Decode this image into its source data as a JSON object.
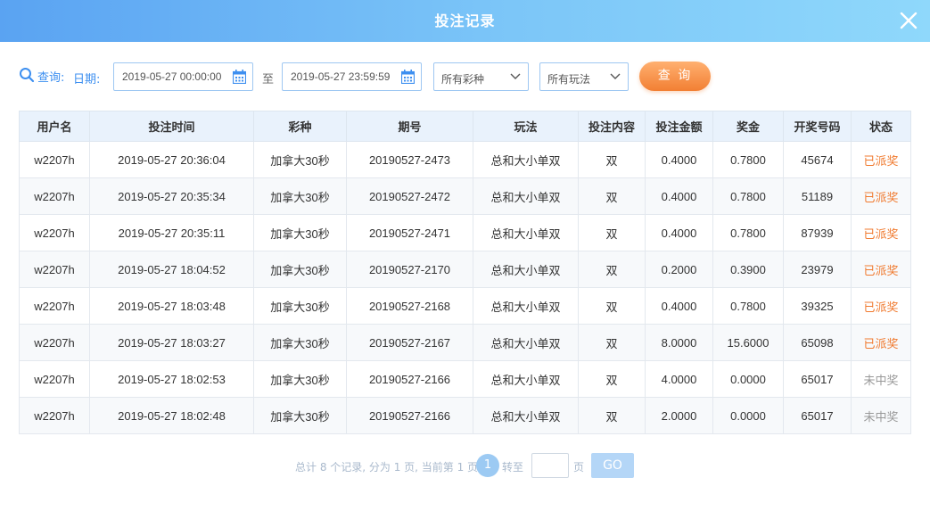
{
  "dialog": {
    "title": "投注记录"
  },
  "filters": {
    "query_label": "查询:",
    "date_label": "日期:",
    "start_date": "2019-05-27 00:00:00",
    "to_label": "至",
    "end_date": "2019-05-27 23:59:59",
    "lottery_select": "所有彩种",
    "play_select": "所有玩法",
    "query_button": "查 询"
  },
  "table": {
    "headers": [
      "用户名",
      "投注时间",
      "彩种",
      "期号",
      "玩法",
      "投注内容",
      "投注金额",
      "奖金",
      "开奖号码",
      "状态"
    ],
    "rows": [
      [
        "w2207h",
        "2019-05-27 20:36:04",
        "加拿大30秒",
        "20190527-2473",
        "总和大小单双",
        "双",
        "0.4000",
        "0.7800",
        "45674",
        "已派奖"
      ],
      [
        "w2207h",
        "2019-05-27 20:35:34",
        "加拿大30秒",
        "20190527-2472",
        "总和大小单双",
        "双",
        "0.4000",
        "0.7800",
        "51189",
        "已派奖"
      ],
      [
        "w2207h",
        "2019-05-27 20:35:11",
        "加拿大30秒",
        "20190527-2471",
        "总和大小单双",
        "双",
        "0.4000",
        "0.7800",
        "87939",
        "已派奖"
      ],
      [
        "w2207h",
        "2019-05-27 18:04:52",
        "加拿大30秒",
        "20190527-2170",
        "总和大小单双",
        "双",
        "0.2000",
        "0.3900",
        "23979",
        "已派奖"
      ],
      [
        "w2207h",
        "2019-05-27 18:03:48",
        "加拿大30秒",
        "20190527-2168",
        "总和大小单双",
        "双",
        "0.4000",
        "0.7800",
        "39325",
        "已派奖"
      ],
      [
        "w2207h",
        "2019-05-27 18:03:27",
        "加拿大30秒",
        "20190527-2167",
        "总和大小单双",
        "双",
        "8.0000",
        "15.6000",
        "65098",
        "已派奖"
      ],
      [
        "w2207h",
        "2019-05-27 18:02:53",
        "加拿大30秒",
        "20190527-2166",
        "总和大小单双",
        "双",
        "4.0000",
        "0.0000",
        "65017",
        "未中奖"
      ],
      [
        "w2207h",
        "2019-05-27 18:02:48",
        "加拿大30秒",
        "20190527-2166",
        "总和大小单双",
        "双",
        "2.0000",
        "0.0000",
        "65017",
        "未中奖"
      ]
    ]
  },
  "pager": {
    "summary": "总计 8 个记录, 分为 1 页, 当前第 1 页",
    "current_page": "1",
    "goto_label": "转至",
    "page_unit": "页",
    "go_button": "GO"
  },
  "colors": {
    "accent_blue": "#3d8ff0",
    "status_won": "#f07a2f",
    "status_lost": "#999999",
    "query_button": "#f27f33"
  }
}
